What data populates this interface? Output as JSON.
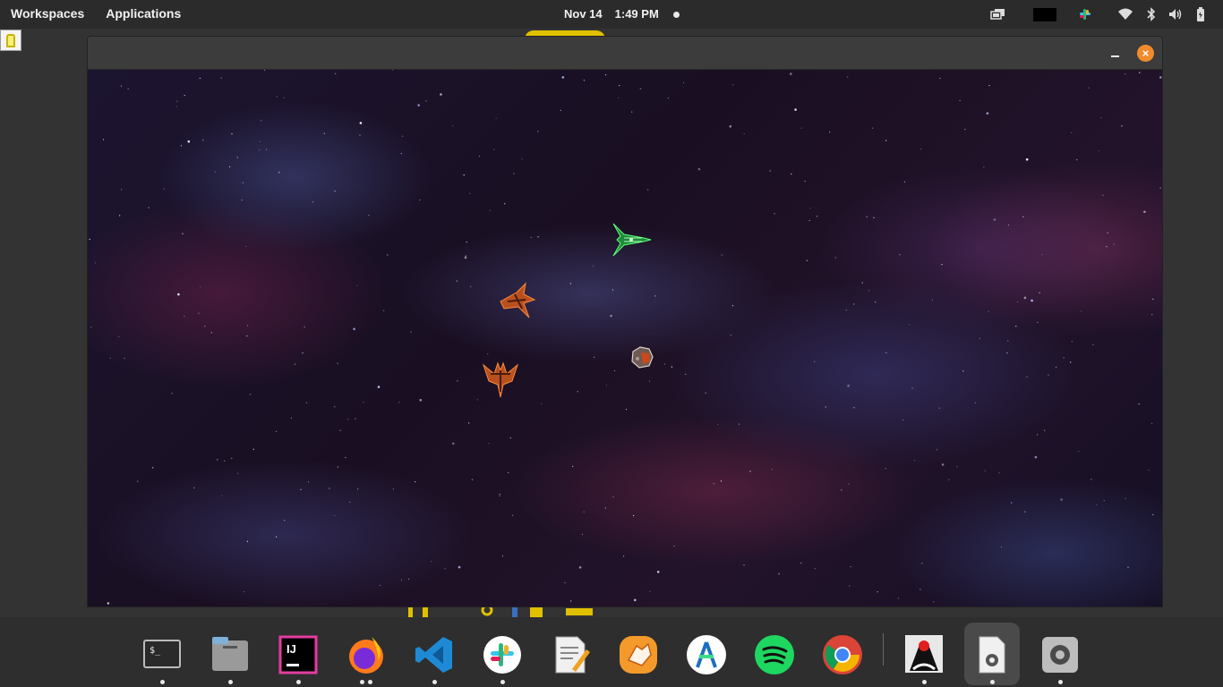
{
  "topbar": {
    "workspaces": "Workspaces",
    "applications": "Applications",
    "date": "Nov 14",
    "time": "1:49 PM",
    "tray_icons": [
      "display-icon",
      "black-rect-icon",
      "slack-tray-icon",
      "wifi-icon",
      "bluetooth-icon",
      "volume-icon",
      "battery-icon"
    ]
  },
  "window": {
    "title": "",
    "controls": {
      "minimize": "–",
      "close": "×"
    },
    "accent": "#f18b2b"
  },
  "game": {
    "sprites": [
      "green-starfighter",
      "orange-enemy-ship-1",
      "orange-enemy-ship-2",
      "asteroid"
    ]
  },
  "dock": {
    "items": [
      {
        "name": "terminal",
        "running": 1
      },
      {
        "name": "files",
        "running": 1
      },
      {
        "name": "intellij-idea",
        "running": 1,
        "label": "IJ"
      },
      {
        "name": "firefox",
        "running": 2
      },
      {
        "name": "vs-code",
        "running": 1
      },
      {
        "name": "slack",
        "running": 1
      },
      {
        "name": "text-editor",
        "running": 0
      },
      {
        "name": "bravo-app",
        "running": 0
      },
      {
        "name": "android-studio",
        "running": 0
      },
      {
        "name": "spotify",
        "running": 0
      },
      {
        "name": "chrome",
        "running": 0
      },
      {
        "name": "java",
        "running": 1
      },
      {
        "name": "settings-file",
        "running": 1,
        "active": true
      },
      {
        "name": "system-settings",
        "running": 1
      }
    ]
  }
}
